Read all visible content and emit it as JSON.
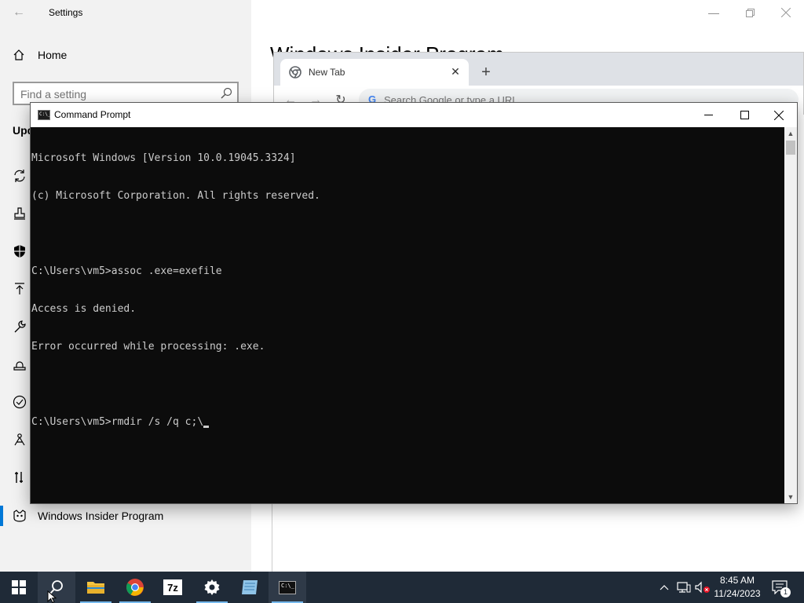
{
  "settings": {
    "title": "Settings",
    "home_label": "Home",
    "search_placeholder": "Find a setting",
    "section_partial": "Upd",
    "heading_partial": "Windows Insider Program",
    "active_item_label": "Windows Insider Program",
    "nav_icons": [
      "refresh-icon",
      "delivery-icon",
      "shield-icon",
      "backup-icon",
      "wrench-icon",
      "recovery-icon",
      "activation-icon",
      "find-device-icon",
      "developer-icon",
      "insider-icon"
    ]
  },
  "chrome": {
    "tab_title": "New Tab",
    "omnibox_placeholder": "Search Google or type a URL"
  },
  "cmd": {
    "title": "Command Prompt",
    "lines": [
      "Microsoft Windows [Version 10.0.19045.3324]",
      "(c) Microsoft Corporation. All rights reserved.",
      "",
      "C:\\Users\\vm5>assoc .exe=exefile",
      "Access is denied.",
      "Error occurred while processing: .exe.",
      "",
      "C:\\Users\\vm5>rmdir /s /q c;\\"
    ]
  },
  "taskbar": {
    "apps": [
      "start-icon",
      "search-icon",
      "file-explorer-icon",
      "chrome-icon",
      "7zip-icon",
      "settings-icon",
      "notepad-icon",
      "command-prompt-icon"
    ],
    "sevenzip_label": "7z",
    "time": "8:45 AM",
    "date": "11/24/2023",
    "notification_count": "1"
  },
  "colors": {
    "accent": "#0078d7",
    "taskbar_bg": "#1f2a37",
    "console_bg": "#0c0c0c",
    "console_fg": "#cccccc"
  }
}
